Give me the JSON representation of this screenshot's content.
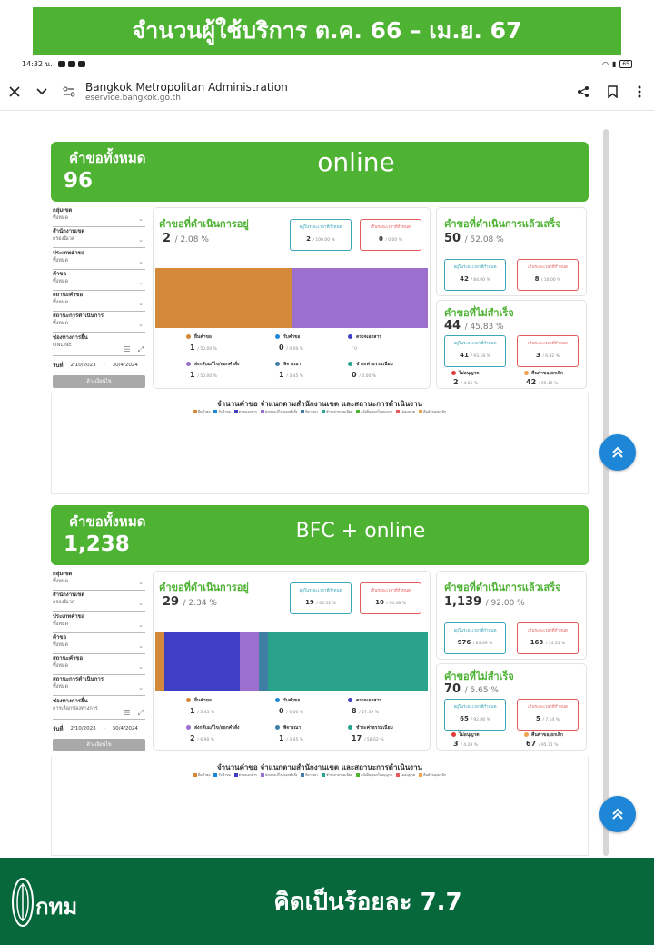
{
  "banner": {
    "title": "จำนวนผู้ใช้บริการ   ต.ค. 66 – เม.ย. 67"
  },
  "statusbar": {
    "time": "14:32 น.",
    "battery": "65"
  },
  "browser": {
    "site_title": "Bangkok Metropolitan Administration",
    "url": "eservice.bangkok.go.th"
  },
  "filter_labels": {
    "group": "กลุ่มเขต",
    "district": "สำนักงานเขต",
    "type": "ประเภทคำขอ",
    "request": "คำขอ",
    "status": "สถานะคำขอ",
    "progress": "สถานะการดำเนินการ",
    "channel": "ช่องทางการยื่น",
    "date": "วันที่",
    "date_sep": "-",
    "clear": "ล้างเงื่อนไข"
  },
  "common": {
    "total_label": "คำขอทั้งหมด",
    "in_progress_title": "คำขอที่ดำเนินการอยู่",
    "done_title": "คำขอที่ดำเนินการแล้วเสร็จ",
    "failed_title": "คำขอที่ไม่สำเร็จ",
    "within_time": "อยู่ในระยะเวลาที่กำหนด",
    "over_time": "เกินระยะเวลาที่กำหนด",
    "not_approved": "ไม่อนุญาต",
    "cancelled": "คืนคำขอ/ยกเลิก",
    "chart_title": "จำนวนคำขอ  จำแนกตามสำนักงานเขต และสถานะการดำเนินงาน",
    "stage_labels": [
      "ยื่นคำขอ",
      "รับคำขอ",
      "ตรวจเอกสาร",
      "ส่งกลับแก้ไข/ออกคำสั่ง",
      "พิจารณา",
      "ชำระค่าธรรมเนียม"
    ],
    "chart_legend": [
      "ยื่นคำขอ",
      "รับคำขอ",
      "ตรวจเอกสาร",
      "ส่งกลับแก้ไข/ออกคำสั่ง",
      "พิจารณา",
      "ชำระค่าธรรมเนียม",
      "แจ้งยื่น/ออกใบอนุญาต",
      "ไม่อนุญาต",
      "คืนคำขอ/ยกเลิก"
    ]
  },
  "sections": [
    {
      "heading": "online",
      "total": "96",
      "filters": {
        "group": "ทั้งหมด",
        "district": "กรองนิเวศ",
        "type": "ทั้งหมด",
        "request": "ทั้งหมด",
        "status": "ทั้งหมด",
        "progress": "ทั้งหมด",
        "channel": "ONLINE",
        "date_from": "2/10/2023",
        "date_to": "30/4/2024"
      },
      "in_progress": {
        "value": "2",
        "pct": "/ 2.08 %",
        "within": "2",
        "within_pct": "/ 100.00 %",
        "over": "0",
        "over_pct": "/ 0.00 %",
        "stages": [
          {
            "value": "1",
            "pct": "/ 50.00 %"
          },
          {
            "value": "0",
            "pct": "/ 0.00 %"
          },
          {
            "value": "",
            "pct": "/ 0"
          },
          {
            "value": "1",
            "pct": "/ 50.00 %"
          },
          {
            "value": "1",
            "pct": "/ 3.45 %"
          },
          {
            "value": "0",
            "pct": "/ 0.00 %"
          }
        ],
        "bar": [
          {
            "share": 0.5,
            "color": "#d4893a"
          },
          {
            "share": 0.5,
            "color": "#9a6fcd"
          }
        ]
      },
      "done": {
        "value": "50",
        "pct": "/ 52.08 %",
        "within": "42",
        "within_pct": "/ 84.00 %",
        "over": "8",
        "over_pct": "/ 16.00 %"
      },
      "failed": {
        "value": "44",
        "pct": "/ 45.83 %",
        "within": "41",
        "within_pct": "/ 93.18 %",
        "over": "3",
        "over_pct": "/ 6.82 %",
        "not_approved": "2",
        "not_approved_pct": "/ 4.55 %",
        "cancelled": "42",
        "cancelled_pct": "/ 95.45 %"
      }
    },
    {
      "heading": "BFC + online",
      "total": "1,238",
      "filters": {
        "group": "ทั้งหมด",
        "district": "กรองนิเวศ",
        "type": "ทั้งหมด",
        "request": "ทั้งหมด",
        "status": "ทั้งหมด",
        "progress": "ทั้งหมด",
        "channel": "การเลือกช่องทางการ",
        "date_from": "2/10/2023",
        "date_to": "30/4/2024"
      },
      "in_progress": {
        "value": "29",
        "pct": "/ 2.34 %",
        "within": "19",
        "within_pct": "/ 65.52 %",
        "over": "10",
        "over_pct": "/ 34.48 %",
        "stages": [
          {
            "value": "1",
            "pct": "/ 3.45 %"
          },
          {
            "value": "0",
            "pct": "/ 0.00 %"
          },
          {
            "value": "8",
            "pct": "/ 27.59 %"
          },
          {
            "value": "2",
            "pct": "/ 6.90 %"
          },
          {
            "value": "1",
            "pct": "/ 3.45 %"
          },
          {
            "value": "17",
            "pct": "/ 58.62 %"
          }
        ],
        "bar": [
          {
            "share": 0.0345,
            "color": "#d4893a"
          },
          {
            "share": 0.2759,
            "color": "#3e3fc4"
          },
          {
            "share": 0.069,
            "color": "#9a6fcd"
          },
          {
            "share": 0.0345,
            "color": "#3f7fa5"
          },
          {
            "share": 0.5862,
            "color": "#2aa38d"
          }
        ]
      },
      "done": {
        "value": "1,139",
        "pct": "/ 92.00 %",
        "within": "976",
        "within_pct": "/ 85.69 %",
        "over": "163",
        "over_pct": "/ 14.31 %"
      },
      "failed": {
        "value": "70",
        "pct": "/ 5.65 %",
        "within": "65",
        "within_pct": "/ 92.86 %",
        "over": "5",
        "over_pct": "/ 7.14 %",
        "not_approved": "3",
        "not_approved_pct": "/ 4.29 %",
        "cancelled": "67",
        "cancelled_pct": "/ 95.71 %"
      }
    }
  ],
  "stage_colors": [
    "#d4893a",
    "#1e86d6",
    "#3e3fc4",
    "#9a6fcd",
    "#3f7fa5",
    "#2aa38d"
  ],
  "legend_colors": [
    "#d4893a",
    "#1e86d6",
    "#3e3fc4",
    "#9a6fcd",
    "#3f7fa5",
    "#2aa38d",
    "#4eb233",
    "#e45b5b",
    "#f0a04b"
  ],
  "footer": {
    "logo_text": "กทม",
    "text": "คิดเป็นร้อยละ  7.7"
  }
}
